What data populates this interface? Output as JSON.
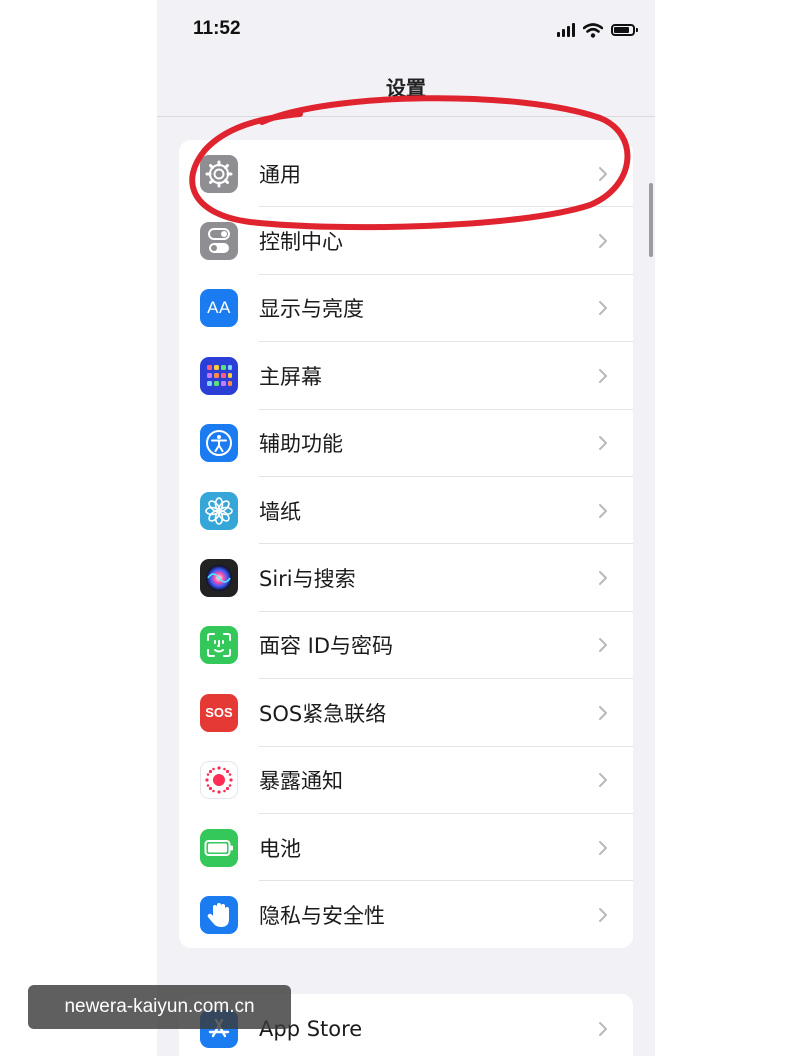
{
  "status_bar": {
    "time": "11:52"
  },
  "nav": {
    "title": "设置"
  },
  "settings": {
    "items": [
      {
        "label": "通用",
        "icon": "gear-icon",
        "color": "#8e8e93"
      },
      {
        "label": "控制中心",
        "icon": "toggles-icon",
        "color": "#8e8e93"
      },
      {
        "label": "显示与亮度",
        "icon": "text-size-icon",
        "color": "#1b7cf2",
        "icon_text": "AA"
      },
      {
        "label": "主屏幕",
        "icon": "home-screen-grid-icon",
        "color": "#2b3fd6"
      },
      {
        "label": "辅助功能",
        "icon": "accessibility-icon",
        "color": "#1b7cf2"
      },
      {
        "label": "墙纸",
        "icon": "flower-icon",
        "color": "#36a6d8"
      },
      {
        "label": "Siri与搜索",
        "icon": "siri-icon",
        "color": "#222222"
      },
      {
        "label": "面容 ID与密码",
        "icon": "face-id-icon",
        "color": "#34c759"
      },
      {
        "label": "SOS紧急联络",
        "icon": "sos-icon",
        "color": "#e53935",
        "icon_text": "SOS"
      },
      {
        "label": "暴露通知",
        "icon": "exposure-notification-icon",
        "color": "#ffffff"
      },
      {
        "label": "电池",
        "icon": "battery-icon",
        "color": "#34c759"
      },
      {
        "label": "隐私与安全性",
        "icon": "hand-icon",
        "color": "#1b7cf2"
      }
    ],
    "second_group": [
      {
        "label": "App Store",
        "icon": "app-store-icon",
        "color": "#1b7cf2"
      }
    ]
  },
  "annotation": {
    "color": "#e0242f"
  },
  "watermark": {
    "text": "newera-kaiyun.com.cn"
  }
}
